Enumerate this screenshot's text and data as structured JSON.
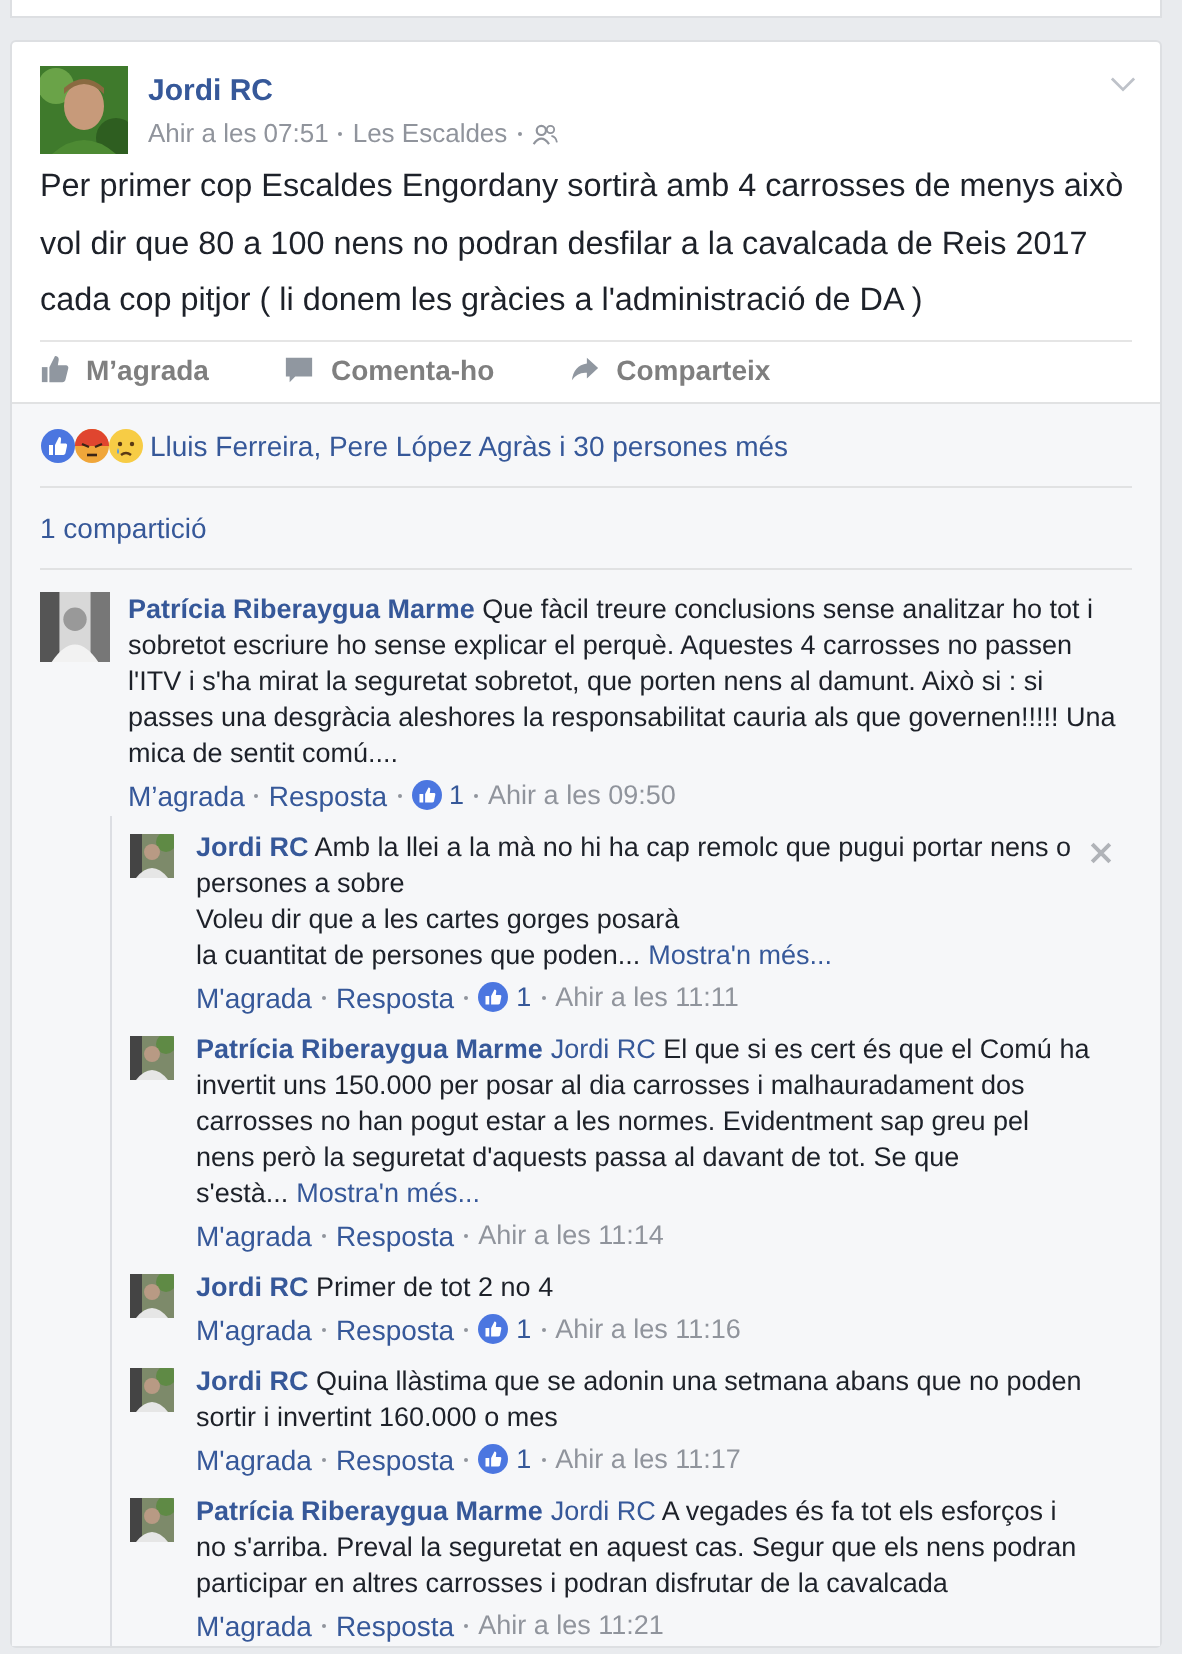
{
  "post": {
    "author": "Jordi RC",
    "time": "Ahir a les 07:51",
    "place": "Les Escaldes",
    "text": "Per primer cop Escaldes Engordany sortirà amb 4 carrosses de menys això vol dir que 80 a 100 nens no podran desfilar a la cavalcada de Reis 2017 cada cop pitjor ( li donem les gràcies a l'administració de DA )",
    "actions": [
      {
        "kind": "like",
        "label": "M’agrada"
      },
      {
        "kind": "comment",
        "label": "Comenta-ho"
      },
      {
        "kind": "share",
        "label": "Comparteix"
      }
    ]
  },
  "reactions": {
    "icons": [
      {
        "kind": "like"
      },
      {
        "kind": "angry"
      },
      {
        "kind": "sad"
      }
    ],
    "text": "Lluis Ferreira, Pere López Agràs i 30 persones més"
  },
  "shares": "1 compartició",
  "comments": [
    {
      "author": "Patrícia Riberaygua Marme",
      "text": "Que fàcil treure conclusions sense analitzar ho tot i sobretot escriure ho sense explicar el perquè. Aquestes 4 carrosses no passen l'ITV i s'ha mirat la seguretat sobretot, que porten nens al damunt. Això si : si passes una desgràcia aleshores la responsabilitat cauria als que governen!!!!! Una mica de sentit comú....",
      "like": "M’agrada",
      "reply": "Resposta",
      "likes": "1",
      "time": "Ahir a les 09:50",
      "replies": [
        {
          "author": "Jordi RC",
          "text": "Amb la llei a la mà no hi ha cap remolc que pugui portar nens o persones a sobre\nVoleu dir que a les cartes gorges posarà\nla cuantitat de persones que poden...",
          "more": "Mostra'n més...",
          "like": "M'agrada",
          "reply": "Resposta",
          "likes": "1",
          "time": "Ahir a les 11:11",
          "closable": true
        },
        {
          "author": "Patrícia Riberaygua Marme",
          "mention": "Jordi RC",
          "text": "El que si es cert és que el Comú ha invertit uns 150.000 per posar al dia carrosses i malhauradament dos carrosses no han pogut estar a les normes. Evidentment sap greu pel nens però la seguretat d'aquests passa al davant de tot. Se que s'està...",
          "more": "Mostra'n més...",
          "like": "M'agrada",
          "reply": "Resposta",
          "time": "Ahir a les 11:14",
          "closable": false
        },
        {
          "author": "Jordi RC",
          "text": "Primer de tot 2 no 4",
          "like": "M'agrada",
          "reply": "Resposta",
          "likes": "1",
          "time": "Ahir a les 11:16",
          "closable": false
        },
        {
          "author": "Jordi RC",
          "text": "Quina llàstima que se adonin una setmana abans que no poden sortir i invertint 160.000 o mes",
          "like": "M'agrada",
          "reply": "Resposta",
          "likes": "1",
          "time": "Ahir a les 11:17",
          "closable": false
        },
        {
          "author": "Patrícia Riberaygua Marme",
          "mention": "Jordi RC",
          "text": "A vegades és fa tot els esforços i no s'arriba. Preval la seguretat en aquest cas. Segur que els nens podran participar en altres carrosses i podran disfrutar de la cavalcada",
          "like": "M'agrada",
          "reply": "Resposta",
          "time": "Ahir a les 11:21",
          "closable": false
        }
      ]
    }
  ]
}
